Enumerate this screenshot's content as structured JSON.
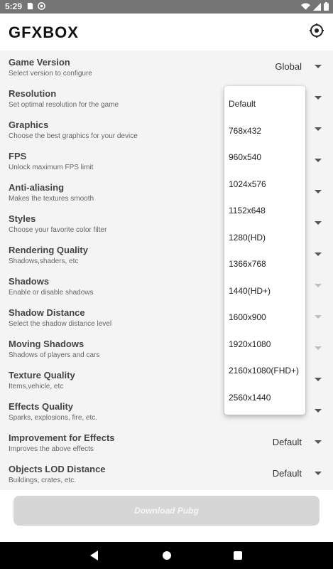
{
  "status_bar": {
    "time": "5:29",
    "icons": [
      "sim-icon",
      "at-icon",
      "wifi-icon",
      "signal-icon",
      "battery-icon"
    ]
  },
  "app": {
    "title": "GFXBOX",
    "settings_icon": "settings-icon"
  },
  "settings": [
    {
      "label": "Game Version",
      "desc": "Select version to configure",
      "value": "Global"
    },
    {
      "label": "Resolution",
      "desc": "Set optimal resolution for the game",
      "value": ""
    },
    {
      "label": "Graphics",
      "desc": "Choose the best graphics for your device",
      "value": ""
    },
    {
      "label": "FPS",
      "desc": "Unlock maximum FPS limit",
      "value": ""
    },
    {
      "label": "Anti-aliasing",
      "desc": "Makes the textures smooth",
      "value": ""
    },
    {
      "label": "Styles",
      "desc": "Choose your favorite color filter",
      "value": ""
    },
    {
      "label": "Rendering Quality",
      "desc": "Shadows,shaders, etc",
      "value": ""
    },
    {
      "label": "Shadows",
      "desc": "Enable or disable shadows",
      "value": ""
    },
    {
      "label": "Shadow Distance",
      "desc": "Select the shadow distance level",
      "value": ""
    },
    {
      "label": "Moving Shadows",
      "desc": "Shadows of players and cars",
      "value": ""
    },
    {
      "label": "Texture Quality",
      "desc": "Items,vehicle, etc",
      "value": ""
    },
    {
      "label": "Effects Quality",
      "desc": "Sparks, explosions, fire, etc.",
      "value": ""
    },
    {
      "label": "Improvement for Effects",
      "desc": "Improves the above effects",
      "value": "Default"
    },
    {
      "label": "Objects LOD Distance",
      "desc": "Buildings, crates, etc.",
      "value": "Default"
    }
  ],
  "resolution_dropdown": {
    "options": [
      "Default",
      "768x432",
      "960x540",
      "1024x576",
      "1152x648",
      "1280(HD)",
      "1366x768",
      "1440(HD+)",
      "1600x900",
      "1920x1080",
      "2160x1080(FHD+)",
      "2560x1440"
    ]
  },
  "download_button": {
    "label": "Download Pubg",
    "enabled": false
  },
  "nav_bar": {
    "icons": [
      "back-icon",
      "home-icon",
      "recents-icon"
    ]
  },
  "colors": {
    "status_bar": "#757575",
    "list_background": "#f4f4f4",
    "button_disabled": "#d6d6d6",
    "nav_bar": "#000000"
  }
}
